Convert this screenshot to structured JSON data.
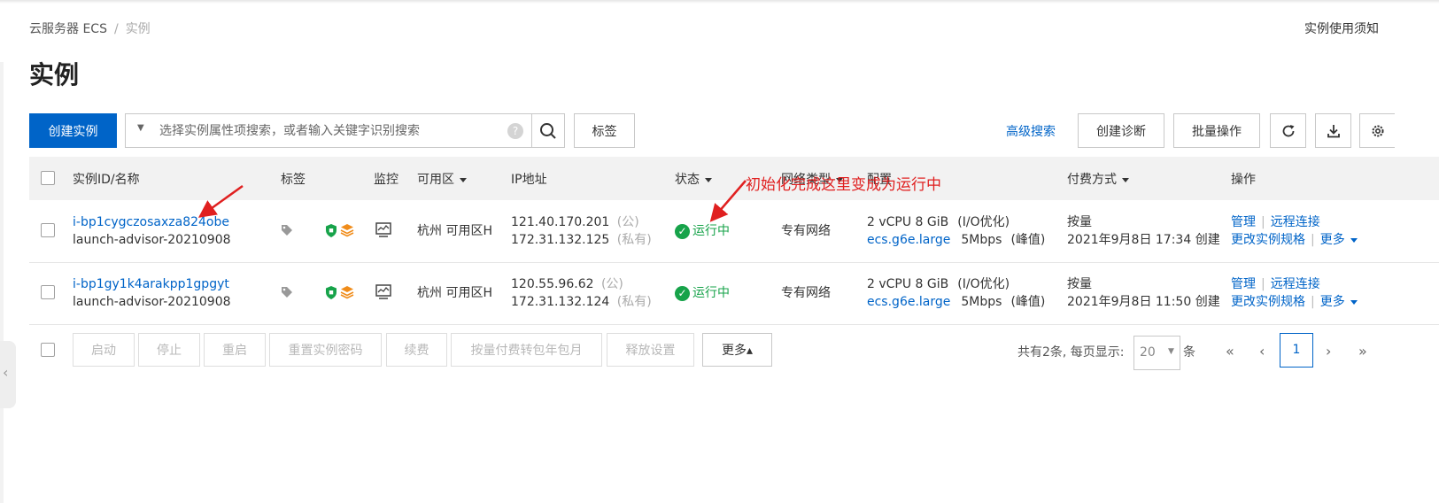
{
  "breadcrumb": {
    "root": "云服务器 ECS",
    "separator": "/",
    "current": "实例"
  },
  "top_right_link": "实例使用须知",
  "page_title": "实例",
  "toolbar": {
    "create_label": "创建实例",
    "search_placeholder": "选择实例属性项搜索，或者输入关键字识别搜索",
    "help_glyph": "?",
    "tags_label": "标签",
    "advanced_search": "高级搜索",
    "create_diagnosis": "创建诊断",
    "batch_ops": "批量操作"
  },
  "table": {
    "headers": {
      "id_name": "实例ID/名称",
      "tags": "标签",
      "monitor": "监控",
      "zone": "可用区",
      "ip": "IP地址",
      "status": "状态",
      "network": "网络类型",
      "config": "配置",
      "billing": "付费方式",
      "actions": "操作"
    },
    "rows": [
      {
        "id": "i-bp1cygczosaxza824obe",
        "name": "launch-advisor-20210908",
        "zone": "杭州 可用区H",
        "public_ip": "121.40.170.201",
        "public_tag": "(公)",
        "private_ip": "172.31.132.125",
        "private_tag": "(私有)",
        "status": "运行中",
        "network": "专有网络",
        "cpu_mem": "2 vCPU 8 GiB",
        "io": "(I/O优化)",
        "spec": "ecs.g6e.large",
        "bandwidth": "5Mbps",
        "bandwidth_tag": "(峰值)",
        "billing_type": "按量",
        "created": "2021年9月8日 17:34 创建",
        "action_manage": "管理",
        "action_remote": "远程连接",
        "action_change_spec": "更改实例规格",
        "action_more": "更多"
      },
      {
        "id": "i-bp1gy1k4arakpp1gpgyt",
        "name": "launch-advisor-20210908",
        "zone": "杭州 可用区H",
        "public_ip": "120.55.96.62",
        "public_tag": "(公)",
        "private_ip": "172.31.132.124",
        "private_tag": "(私有)",
        "status": "运行中",
        "network": "专有网络",
        "cpu_mem": "2 vCPU 8 GiB",
        "io": "(I/O优化)",
        "spec": "ecs.g6e.large",
        "bandwidth": "5Mbps",
        "bandwidth_tag": "(峰值)",
        "billing_type": "按量",
        "created": "2021年9月8日 11:50 创建",
        "action_manage": "管理",
        "action_remote": "远程连接",
        "action_change_spec": "更改实例规格",
        "action_more": "更多"
      }
    ]
  },
  "footer": {
    "start": "启动",
    "stop": "停止",
    "restart": "重启",
    "reset_password": "重置实例密码",
    "renew": "续费",
    "convert_billing": "按量付费转包年包月",
    "release": "释放设置",
    "more": "更多▴",
    "total_text": "共有2条, 每页显示:",
    "page_size": "20",
    "page_size_caret": "▼",
    "unit": "条",
    "first": "«",
    "prev": "‹",
    "current_page": "1",
    "next": "›",
    "last": "»"
  },
  "annotation": {
    "text": "初始化完成这里变成为运行中",
    "color": "#e02020"
  },
  "colors": {
    "primary": "#0064c8",
    "running": "#17a34a",
    "annotation": "#e02020"
  }
}
